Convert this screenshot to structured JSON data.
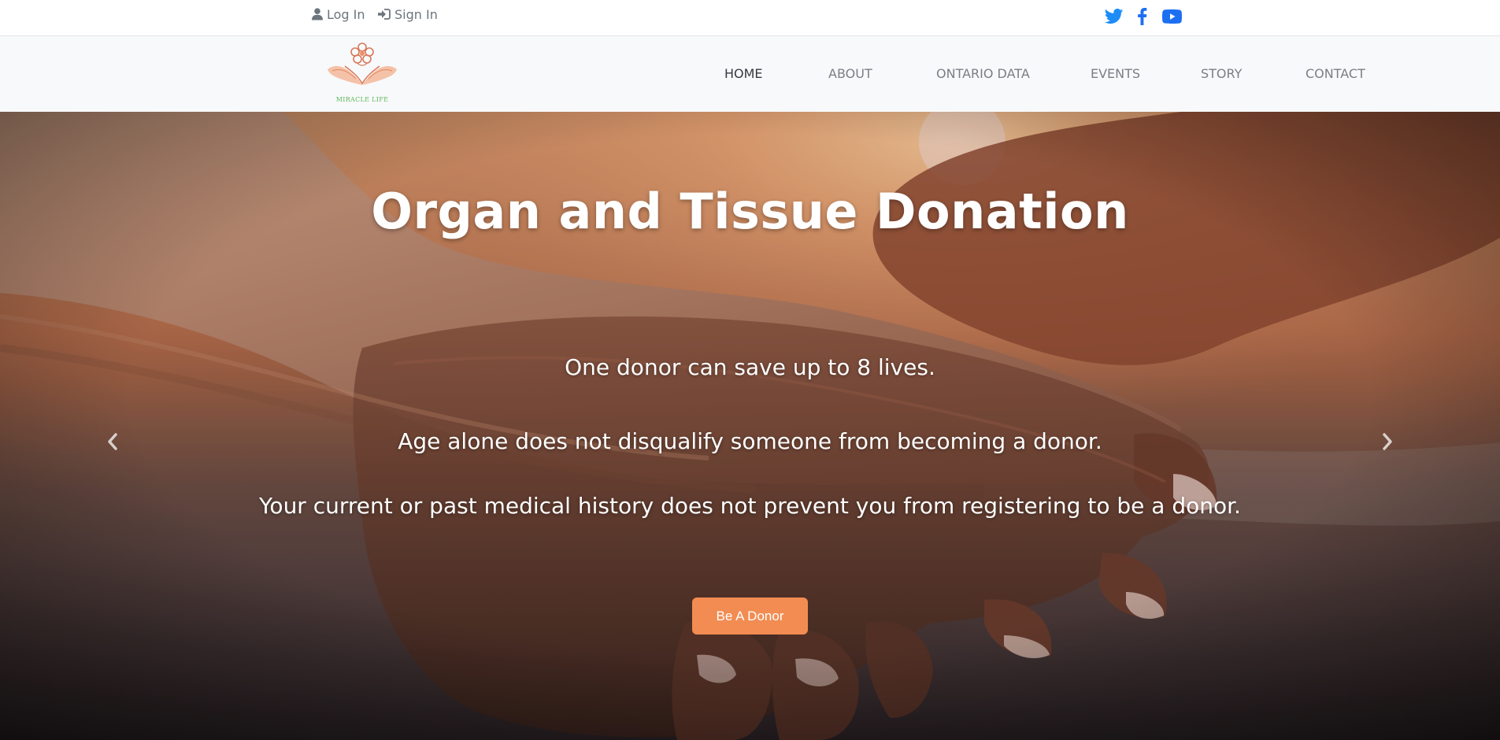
{
  "topbar": {
    "login_label": "Log In",
    "signin_label": "Sign In",
    "social": [
      {
        "icon": "twitter-icon",
        "color": "#1d8cf8"
      },
      {
        "icon": "facebook-icon",
        "color": "#1d6ff2"
      },
      {
        "icon": "youtube-icon",
        "color": "#1d6ff2"
      }
    ]
  },
  "brand": {
    "logo_text": "MIRACLE LIFE"
  },
  "nav": {
    "items": [
      {
        "label": "HOME",
        "active": true
      },
      {
        "label": "ABOUT"
      },
      {
        "label": "ONTARIO DATA"
      },
      {
        "label": "EVENTS"
      },
      {
        "label": "STORY"
      },
      {
        "label": "CONTACT"
      }
    ]
  },
  "hero": {
    "title": "Organ and Tissue Donation",
    "lines": [
      "One donor can save up to 8 lives.",
      "Age alone does not disqualify someone from becoming a donor.",
      "Your current or past medical history does not prevent you from registering to be a donor."
    ],
    "cta_label": "Be A Donor",
    "prev_icon": "chevron-left-icon",
    "next_icon": "chevron-right-icon"
  },
  "colors": {
    "accent": "#f28c52",
    "social_blue": "#1d6ff2",
    "nav_active": "#343a40",
    "nav_text": "#7a7f85"
  }
}
